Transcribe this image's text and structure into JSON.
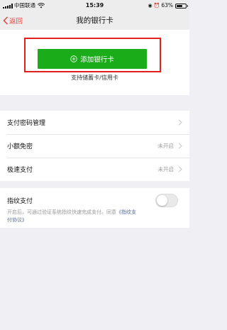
{
  "status_bar": {
    "carrier": "中国联通",
    "time": "15:39",
    "battery_percent": "63%",
    "battery_level": 0.63,
    "icons": [
      "signal-icon",
      "wifi-icon",
      "location-icon",
      "alarm-icon",
      "battery-icon"
    ]
  },
  "nav": {
    "back_label": "返回",
    "title": "我的银行卡"
  },
  "add_card": {
    "button_label": "添加银行卡",
    "support_text": "支持储蓄卡/信用卡"
  },
  "settings": {
    "items": [
      {
        "label": "支付密码管理",
        "value": ""
      },
      {
        "label": "小额免密",
        "value": "未开启"
      },
      {
        "label": "极速支付",
        "value": "未开启"
      }
    ]
  },
  "fingerprint": {
    "label": "指纹支付",
    "enabled": false,
    "desc_prefix": "开启后，可通过验证系统指纹快速完成支付。同意",
    "desc_link": "《指纹支付协议》"
  },
  "colors": {
    "accent_red": "#e64340",
    "button_green": "#1aad19",
    "highlight_red": "#e0201b",
    "link_blue": "#576b95",
    "background": "#efeff4"
  }
}
